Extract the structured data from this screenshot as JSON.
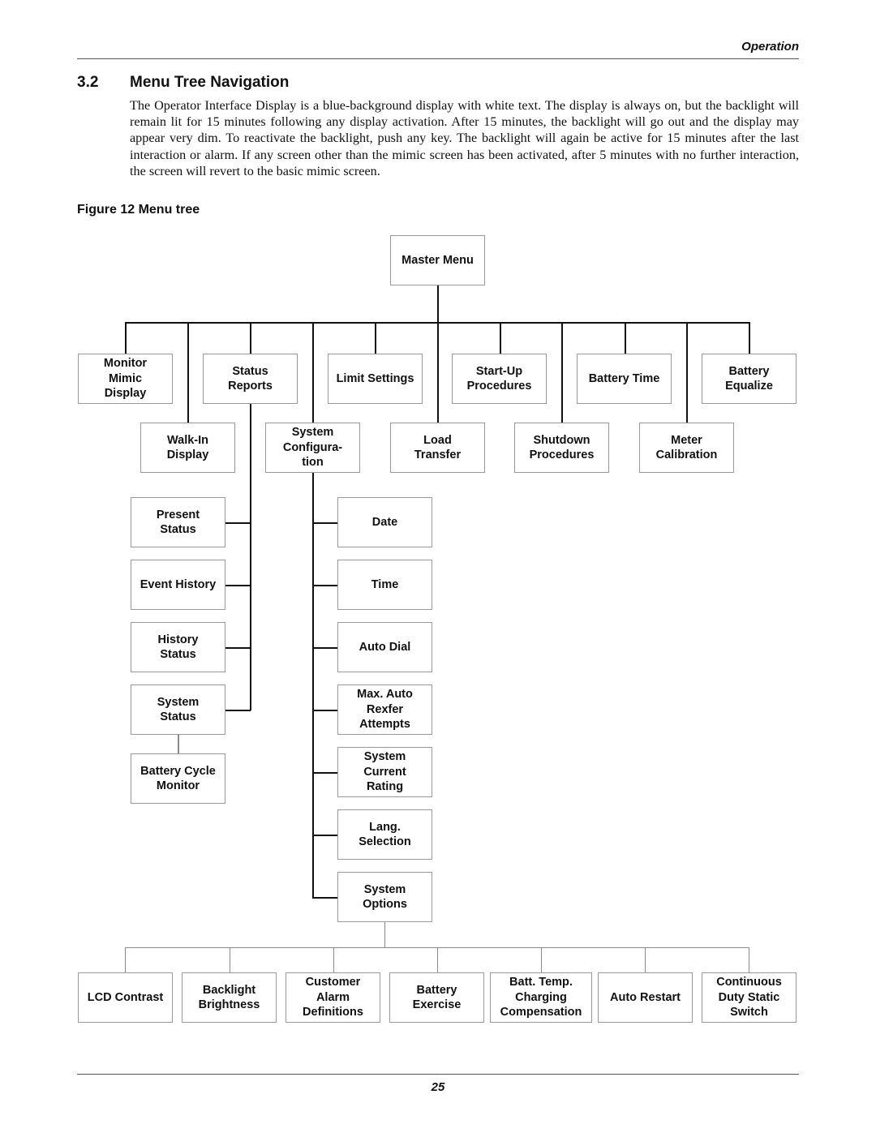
{
  "header": {
    "section_label": "Operation"
  },
  "section": {
    "number": "3.2",
    "title": "Menu Tree Navigation",
    "body": "The Operator Interface Display is a blue-background display with white text. The display is always on, but the backlight will remain lit for 15 minutes following any display activation. After 15 minutes, the backlight will go out and the display may appear very dim. To reactivate the backlight, push any key. The backlight will again be active for 15 minutes after the last interaction or alarm. If any screen other than the mimic screen has been activated, after 5 minutes with no further interaction, the screen will revert to the basic mimic screen."
  },
  "figure": {
    "caption": "Figure 12  Menu tree",
    "root": "Master Menu",
    "level1": [
      "Monitor\nMimic\nDisplay",
      "Walk-In\nDisplay",
      "Status\nReports",
      "System\nConfigura-\ntion",
      "Limit Settings",
      "Load\nTransfer",
      "Start-Up\nProcedures",
      "Shutdown\nProcedures",
      "Battery Time",
      "Meter\nCalibration",
      "Battery\nEqualize"
    ],
    "status_reports_children": [
      "Present\nStatus",
      "Event History",
      "History\nStatus",
      "System\nStatus"
    ],
    "system_status_child": "Battery Cycle\nMonitor",
    "system_config_children": [
      "Date",
      "Time",
      "Auto Dial",
      "Max. Auto\nRexfer\nAttempts",
      "System\nCurrent\nRating",
      "Lang.\nSelection",
      "System\nOptions"
    ],
    "system_options_children": [
      "LCD Contrast",
      "Backlight\nBrightness",
      "Customer\nAlarm\nDefinitions",
      "Battery\nExercise",
      "Batt. Temp.\nCharging\nCompensation",
      "Auto Restart",
      "Continuous\nDuty Static\nSwitch"
    ]
  },
  "footer": {
    "page_number": "25"
  }
}
